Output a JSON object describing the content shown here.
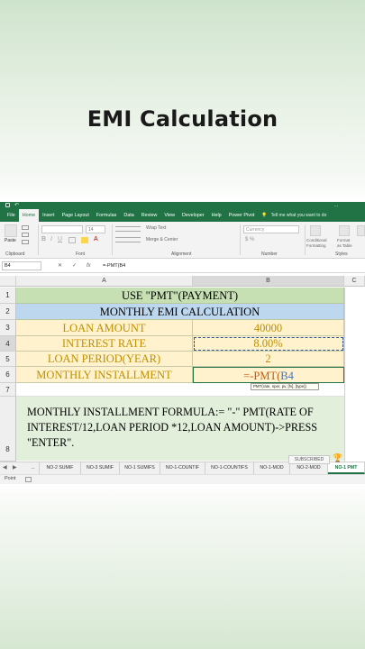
{
  "page_title": "EMI Calculation",
  "titlebar_text": "...",
  "ribbon_tabs": [
    "File",
    "Home",
    "Insert",
    "Page Layout",
    "Formulas",
    "Data",
    "Review",
    "View",
    "Developer",
    "Help",
    "Power Pivot"
  ],
  "tell_me": "Tell me what you want to do",
  "ribbon": {
    "paste": "Paste",
    "font_name": "",
    "font_size": "14",
    "wrap_text": "Wrap Text",
    "merge_center": "Merge & Center",
    "number_format": "Currency",
    "conditional_formatting": "Conditional Formatting",
    "format_as_table": "Format as Table",
    "cell_styles": "Cell Styles",
    "groups": {
      "clipboard": "Clipboard",
      "font": "Font",
      "alignment": "Alignment",
      "number": "Number",
      "styles": "Styles"
    }
  },
  "formula_bar": {
    "name_box": "B4",
    "cancel": "✕",
    "enter": "✓",
    "fx": "fx",
    "content": "=-PMT(B4"
  },
  "columns": [
    "A",
    "B",
    "C"
  ],
  "rows": [
    "1",
    "2",
    "3",
    "4",
    "5",
    "6",
    "7",
    "8"
  ],
  "sheet": {
    "r1": "USE \"PMT\"(PAYMENT)",
    "r2": "MONTHLY EMI CALCULATION",
    "r3_label": "LOAN AMOUNT",
    "r3_value": "40000",
    "r4_label": "INTEREST RATE",
    "r4_value": "8.00%",
    "r5_label": "LOAN PERIOD(YEAR)",
    "r5_value": "2",
    "r6_label": "MONTHLY INSTALLMENT",
    "r6_formula_prefix": "=-PMT(",
    "r6_formula_ref": "B4",
    "tooltip": "PMT(rate, nper, pv, [fv], [type])",
    "r8_note": "MONTHLY INSTALLMENT FORMULA:= \"-\" PMT(RATE OF INTEREST/12,LOAN PERIOD *12,LOAN AMOUNT)->PRESS \"ENTER\"."
  },
  "sheet_tabs": [
    "...",
    "NO-2 SUMIF",
    "NO-3 SUMIF",
    "NO-1 SUMIFS",
    "NO-1-COUNTIF",
    "NO-1-COUNTIFS",
    "NO-1-MOD",
    "NO-2-MOD",
    "NO-1 PMT"
  ],
  "status": {
    "ready": "Point"
  },
  "overlay": {
    "subscribed": "SUBSCRIBED"
  },
  "colors": {
    "excel_green": "#217346",
    "green_fill": "#c6e0b4",
    "blue_fill": "#bdd7ee",
    "yellow_fill": "#fff2cc",
    "label_gold": "#bf8f00"
  }
}
